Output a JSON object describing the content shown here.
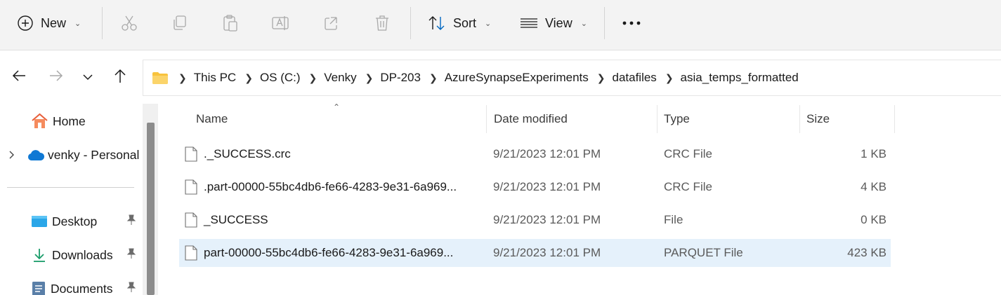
{
  "toolbar": {
    "new_label": "New",
    "sort_label": "Sort",
    "view_label": "View",
    "icons": [
      "plus-circle-icon",
      "cut-icon",
      "copy-icon",
      "paste-icon",
      "rename-icon",
      "share-icon",
      "delete-icon",
      "sort-icon",
      "view-lines-icon",
      "more-icon"
    ]
  },
  "address": {
    "breadcrumbs": [
      "This PC",
      "OS (C:)",
      "Venky",
      "DP-203",
      "AzureSynapseExperiments",
      "datafiles",
      "asia_temps_formatted"
    ]
  },
  "nav": {
    "home": "Home",
    "onedrive": "venky - Personal",
    "quick_access": [
      {
        "label": "Desktop",
        "icon": "desktop-icon"
      },
      {
        "label": "Downloads",
        "icon": "download-icon"
      },
      {
        "label": "Documents",
        "icon": "documents-icon"
      }
    ]
  },
  "columns": {
    "name": "Name",
    "date": "Date modified",
    "type": "Type",
    "size": "Size"
  },
  "files": [
    {
      "name": "._SUCCESS.crc",
      "date": "9/21/2023 12:01 PM",
      "type": "CRC File",
      "size": "1 KB"
    },
    {
      "name": ".part-00000-55bc4db6-fe66-4283-9e31-6a969...",
      "date": "9/21/2023 12:01 PM",
      "type": "CRC File",
      "size": "4 KB"
    },
    {
      "name": "_SUCCESS",
      "date": "9/21/2023 12:01 PM",
      "type": "File",
      "size": "0 KB"
    },
    {
      "name": "part-00000-55bc4db6-fe66-4283-9e31-6a969...",
      "date": "9/21/2023 12:01 PM",
      "type": "PARQUET File",
      "size": "423 KB",
      "selected": true
    }
  ],
  "colors": {
    "toolbar_bg": "#f3f3f3",
    "selected_row": "#e5f1fb",
    "accent_blue": "#0067c0",
    "folder_yellow": "#f8c33d"
  }
}
